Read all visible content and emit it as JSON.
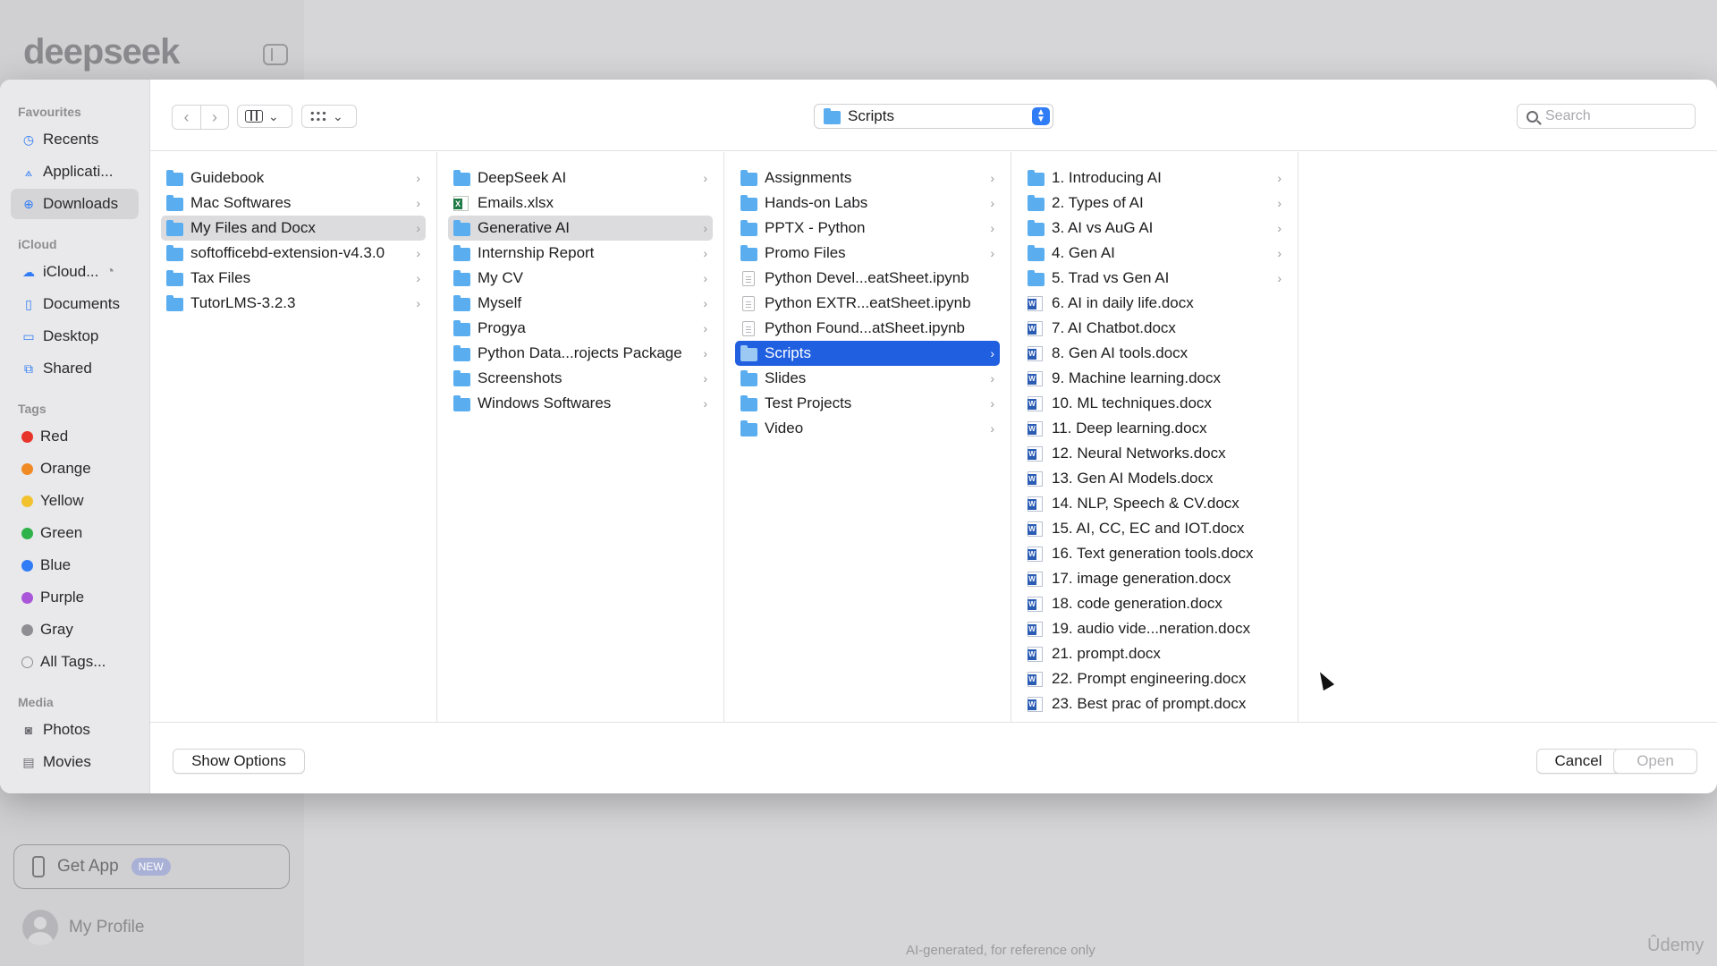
{
  "background_app": {
    "logo": "deepseek",
    "get_app_label": "Get App",
    "new_badge": "NEW",
    "profile_label": "My Profile",
    "disclaimer": "AI-generated, for reference only",
    "watermark": "Ûdemy"
  },
  "sidebar": {
    "favourites_heading": "Favourites",
    "favourites": [
      {
        "label": "Recents",
        "icon": "clock-icon"
      },
      {
        "label": "Applicati...",
        "icon": "applications-icon"
      },
      {
        "label": "Downloads",
        "icon": "downloads-icon",
        "active": true
      }
    ],
    "icloud_heading": "iCloud",
    "icloud": [
      {
        "label": "iCloud...",
        "icon": "cloud-icon"
      },
      {
        "label": "Documents",
        "icon": "document-icon"
      },
      {
        "label": "Desktop",
        "icon": "desktop-icon"
      },
      {
        "label": "Shared",
        "icon": "shared-folder-icon"
      }
    ],
    "tags_heading": "Tags",
    "tags": [
      {
        "label": "Red",
        "color": "#e8352b"
      },
      {
        "label": "Orange",
        "color": "#f08a24"
      },
      {
        "label": "Yellow",
        "color": "#f2c12e"
      },
      {
        "label": "Green",
        "color": "#2fb24a"
      },
      {
        "label": "Blue",
        "color": "#2f7cf6"
      },
      {
        "label": "Purple",
        "color": "#a957d8"
      },
      {
        "label": "Gray",
        "color": "#8e8e93"
      }
    ],
    "all_tags_label": "All Tags...",
    "media_heading": "Media",
    "media": [
      {
        "label": "Photos",
        "icon": "camera-icon"
      },
      {
        "label": "Movies",
        "icon": "film-icon"
      }
    ]
  },
  "toolbar": {
    "location": "Scripts",
    "search_placeholder": "Search"
  },
  "columns": [
    [
      {
        "label": "Guidebook",
        "type": "folder",
        "chevron": true
      },
      {
        "label": "Mac Softwares",
        "type": "folder",
        "chevron": true
      },
      {
        "label": "My Files and Docx",
        "type": "folder",
        "chevron": true,
        "selected": "gray"
      },
      {
        "label": "softofficebd-extension-v4.3.0",
        "type": "folder",
        "chevron": true
      },
      {
        "label": "Tax Files",
        "type": "folder",
        "chevron": true
      },
      {
        "label": "TutorLMS-3.2.3",
        "type": "folder",
        "chevron": true
      }
    ],
    [
      {
        "label": "DeepSeek AI",
        "type": "folder",
        "chevron": true
      },
      {
        "label": "Emails.xlsx",
        "type": "xlsx",
        "chevron": false
      },
      {
        "label": "Generative AI",
        "type": "folder",
        "chevron": true,
        "selected": "gray"
      },
      {
        "label": "Internship Report",
        "type": "folder",
        "chevron": true
      },
      {
        "label": "My CV",
        "type": "folder",
        "chevron": true
      },
      {
        "label": "Myself",
        "type": "folder",
        "chevron": true
      },
      {
        "label": "Progya",
        "type": "folder",
        "chevron": true
      },
      {
        "label": "Python Data...rojects Package",
        "type": "folder",
        "chevron": true
      },
      {
        "label": "Screenshots",
        "type": "folder",
        "chevron": true
      },
      {
        "label": "Windows Softwares",
        "type": "folder",
        "chevron": true
      }
    ],
    [
      {
        "label": "Assignments",
        "type": "folder",
        "chevron": true
      },
      {
        "label": "Hands-on Labs",
        "type": "folder",
        "chevron": true
      },
      {
        "label": "PPTX - Python",
        "type": "folder",
        "chevron": true
      },
      {
        "label": "Promo Files",
        "type": "folder",
        "chevron": true
      },
      {
        "label": "Python Devel...eatSheet.ipynb",
        "type": "file",
        "chevron": false
      },
      {
        "label": "Python EXTR...eatSheet.ipynb",
        "type": "file",
        "chevron": false
      },
      {
        "label": "Python Found...atSheet.ipynb",
        "type": "file",
        "chevron": false
      },
      {
        "label": "Scripts",
        "type": "folder",
        "chevron": true,
        "selected": "blue"
      },
      {
        "label": "Slides",
        "type": "folder",
        "chevron": true
      },
      {
        "label": "Test Projects",
        "type": "folder",
        "chevron": true
      },
      {
        "label": "Video",
        "type": "folder",
        "chevron": true
      }
    ],
    [
      {
        "label": "1. Introducing AI",
        "type": "folder",
        "chevron": true
      },
      {
        "label": "2. Types of AI",
        "type": "folder",
        "chevron": true
      },
      {
        "label": "3. AI vs AuG AI",
        "type": "folder",
        "chevron": true
      },
      {
        "label": "4. Gen AI",
        "type": "folder",
        "chevron": true
      },
      {
        "label": "5. Trad vs Gen AI",
        "type": "folder",
        "chevron": true
      },
      {
        "label": "6. AI in daily life.docx",
        "type": "docx",
        "chevron": false
      },
      {
        "label": "7. AI Chatbot.docx",
        "type": "docx",
        "chevron": false
      },
      {
        "label": "8. Gen AI tools.docx",
        "type": "docx",
        "chevron": false
      },
      {
        "label": "9. Machine learning.docx",
        "type": "docx",
        "chevron": false
      },
      {
        "label": "10. ML techniques.docx",
        "type": "docx",
        "chevron": false
      },
      {
        "label": "11. Deep learning.docx",
        "type": "docx",
        "chevron": false
      },
      {
        "label": "12. Neural Networks.docx",
        "type": "docx",
        "chevron": false
      },
      {
        "label": "13. Gen AI Models.docx",
        "type": "docx",
        "chevron": false
      },
      {
        "label": "14. NLP, Speech & CV.docx",
        "type": "docx",
        "chevron": false
      },
      {
        "label": "15. AI, CC, EC and IOT.docx",
        "type": "docx",
        "chevron": false
      },
      {
        "label": "16. Text generation tools.docx",
        "type": "docx",
        "chevron": false
      },
      {
        "label": "17. image generation.docx",
        "type": "docx",
        "chevron": false
      },
      {
        "label": "18. code generation.docx",
        "type": "docx",
        "chevron": false
      },
      {
        "label": "19. audio vide...neration.docx",
        "type": "docx",
        "chevron": false
      },
      {
        "label": "21. prompt.docx",
        "type": "docx",
        "chevron": false
      },
      {
        "label": "22. Prompt engineering.docx",
        "type": "docx",
        "chevron": false
      },
      {
        "label": "23. Best prac of prompt.docx",
        "type": "docx",
        "chevron": false
      }
    ]
  ],
  "footer": {
    "show_options": "Show Options",
    "cancel": "Cancel",
    "open": "Open"
  }
}
